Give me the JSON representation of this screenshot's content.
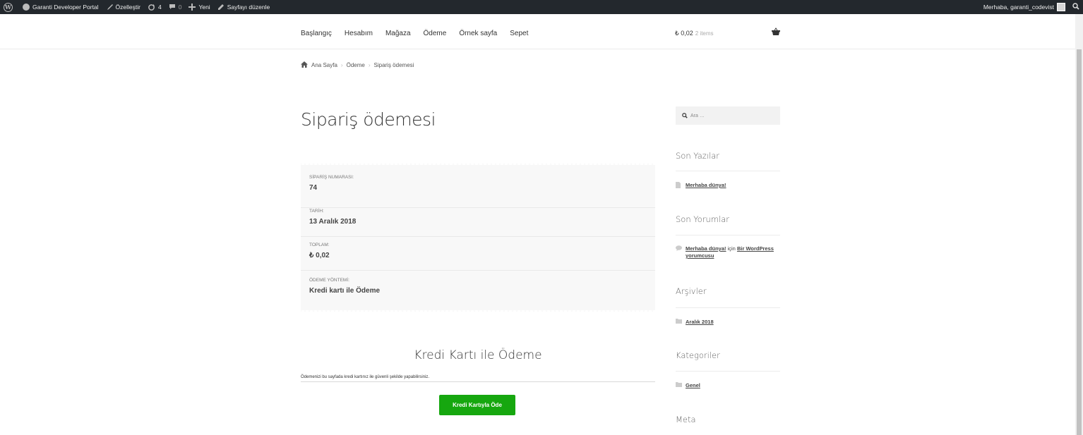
{
  "adminbar": {
    "site_name": "Garanti Developer Portal",
    "customize": "Özelleştir",
    "updates_count": "4",
    "comments_count": "0",
    "new": "Yeni",
    "edit_page": "Sayfayı düzenle",
    "greeting": "Merhaba, garanti_codevist"
  },
  "nav": {
    "items": [
      "Başlangıç",
      "Hesabım",
      "Mağaza",
      "Ödeme",
      "Örnek sayfa",
      "Sepet"
    ]
  },
  "cart": {
    "amount": "₺ 0,02",
    "count": "2 items"
  },
  "breadcrumb": {
    "home": "Ana Sayfa",
    "level1": "Ödeme",
    "level2": "Sipariş ödemesi"
  },
  "page": {
    "title": "Sipariş ödemesi"
  },
  "order": {
    "rows": [
      {
        "label": "SİPARİŞ NUMARASI:",
        "value": "74"
      },
      {
        "label": "TARİH:",
        "value": "13 Aralık 2018"
      },
      {
        "label": "TOPLAM:",
        "value": "₺ 0,02"
      },
      {
        "label": "ÖDEME YÖNTEMİ:",
        "value": "Kredi kartı ile Ödeme"
      }
    ]
  },
  "payment": {
    "title": "Kredi Kartı ile Ödeme",
    "description": "Ödemenizi bu sayfada kredi kartınız ile güvenli şekilde yapabilirsiniz.",
    "button": "Kredi Kartıyla Öde"
  },
  "sidebar": {
    "search_placeholder": "Ara …",
    "recent_posts_title": "Son Yazılar",
    "recent_post": "Merhaba dünya!",
    "recent_comments_title": "Son Yorumlar",
    "comment_post": "Merhaba dünya!",
    "comment_for": " için ",
    "comment_author": "Bir WordPress yorumcusu",
    "archives_title": "Arşivler",
    "archive_item": "Aralık 2018",
    "categories_title": "Kategoriler",
    "category_item": "Genel",
    "meta_title": "Meta"
  },
  "colors": {
    "adminbar_bg": "#23282d",
    "button_green": "#16a70f",
    "overview_bg": "#f8f8f8"
  }
}
